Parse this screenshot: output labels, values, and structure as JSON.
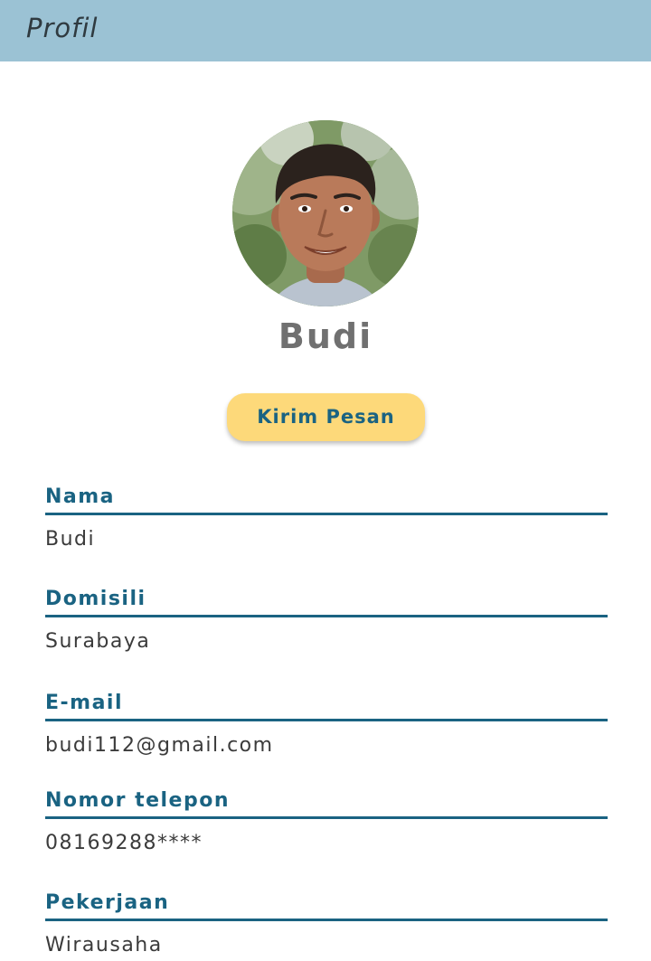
{
  "app_bar": {
    "title": "Profil",
    "color": "#9bc2d4"
  },
  "profile": {
    "name": "Budi",
    "send_button_label": "Kirim Pesan",
    "button_color": "#fdd97a"
  },
  "fields": [
    {
      "label": "Nama",
      "value": "Budi"
    },
    {
      "label": "Domisili",
      "value": "Surabaya"
    },
    {
      "label": "E-mail",
      "value": "budi112@gmail.com"
    },
    {
      "label": "Nomor telepon",
      "value": "08169288****"
    },
    {
      "label": "Pekerjaan",
      "value": "Wirausaha"
    }
  ],
  "accent_color": "#1a6382"
}
